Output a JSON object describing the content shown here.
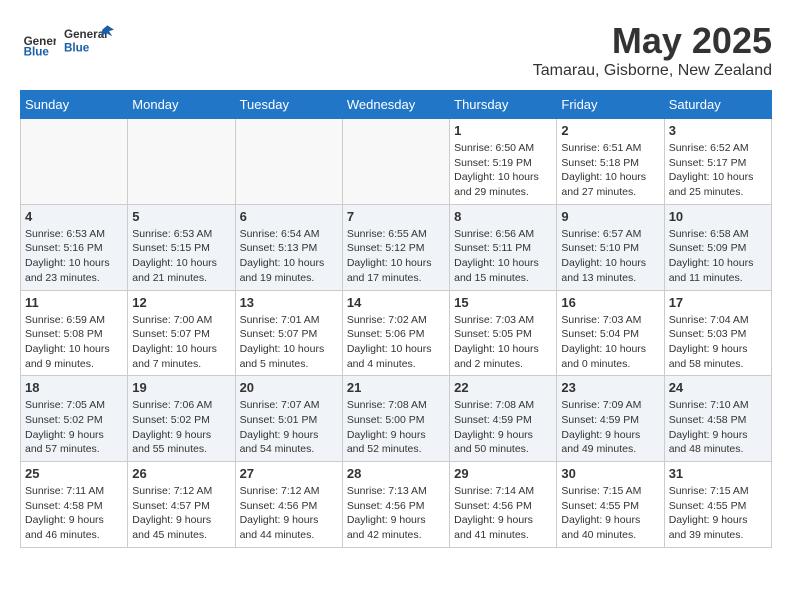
{
  "header": {
    "logo_general": "General",
    "logo_blue": "Blue",
    "month_title": "May 2025",
    "location": "Tamarau, Gisborne, New Zealand"
  },
  "weekdays": [
    "Sunday",
    "Monday",
    "Tuesday",
    "Wednesday",
    "Thursday",
    "Friday",
    "Saturday"
  ],
  "weeks": [
    [
      {
        "day": "",
        "info": ""
      },
      {
        "day": "",
        "info": ""
      },
      {
        "day": "",
        "info": ""
      },
      {
        "day": "",
        "info": ""
      },
      {
        "day": "1",
        "info": "Sunrise: 6:50 AM\nSunset: 5:19 PM\nDaylight: 10 hours\nand 29 minutes."
      },
      {
        "day": "2",
        "info": "Sunrise: 6:51 AM\nSunset: 5:18 PM\nDaylight: 10 hours\nand 27 minutes."
      },
      {
        "day": "3",
        "info": "Sunrise: 6:52 AM\nSunset: 5:17 PM\nDaylight: 10 hours\nand 25 minutes."
      }
    ],
    [
      {
        "day": "4",
        "info": "Sunrise: 6:53 AM\nSunset: 5:16 PM\nDaylight: 10 hours\nand 23 minutes."
      },
      {
        "day": "5",
        "info": "Sunrise: 6:53 AM\nSunset: 5:15 PM\nDaylight: 10 hours\nand 21 minutes."
      },
      {
        "day": "6",
        "info": "Sunrise: 6:54 AM\nSunset: 5:13 PM\nDaylight: 10 hours\nand 19 minutes."
      },
      {
        "day": "7",
        "info": "Sunrise: 6:55 AM\nSunset: 5:12 PM\nDaylight: 10 hours\nand 17 minutes."
      },
      {
        "day": "8",
        "info": "Sunrise: 6:56 AM\nSunset: 5:11 PM\nDaylight: 10 hours\nand 15 minutes."
      },
      {
        "day": "9",
        "info": "Sunrise: 6:57 AM\nSunset: 5:10 PM\nDaylight: 10 hours\nand 13 minutes."
      },
      {
        "day": "10",
        "info": "Sunrise: 6:58 AM\nSunset: 5:09 PM\nDaylight: 10 hours\nand 11 minutes."
      }
    ],
    [
      {
        "day": "11",
        "info": "Sunrise: 6:59 AM\nSunset: 5:08 PM\nDaylight: 10 hours\nand 9 minutes."
      },
      {
        "day": "12",
        "info": "Sunrise: 7:00 AM\nSunset: 5:07 PM\nDaylight: 10 hours\nand 7 minutes."
      },
      {
        "day": "13",
        "info": "Sunrise: 7:01 AM\nSunset: 5:07 PM\nDaylight: 10 hours\nand 5 minutes."
      },
      {
        "day": "14",
        "info": "Sunrise: 7:02 AM\nSunset: 5:06 PM\nDaylight: 10 hours\nand 4 minutes."
      },
      {
        "day": "15",
        "info": "Sunrise: 7:03 AM\nSunset: 5:05 PM\nDaylight: 10 hours\nand 2 minutes."
      },
      {
        "day": "16",
        "info": "Sunrise: 7:03 AM\nSunset: 5:04 PM\nDaylight: 10 hours\nand 0 minutes."
      },
      {
        "day": "17",
        "info": "Sunrise: 7:04 AM\nSunset: 5:03 PM\nDaylight: 9 hours\nand 58 minutes."
      }
    ],
    [
      {
        "day": "18",
        "info": "Sunrise: 7:05 AM\nSunset: 5:02 PM\nDaylight: 9 hours\nand 57 minutes."
      },
      {
        "day": "19",
        "info": "Sunrise: 7:06 AM\nSunset: 5:02 PM\nDaylight: 9 hours\nand 55 minutes."
      },
      {
        "day": "20",
        "info": "Sunrise: 7:07 AM\nSunset: 5:01 PM\nDaylight: 9 hours\nand 54 minutes."
      },
      {
        "day": "21",
        "info": "Sunrise: 7:08 AM\nSunset: 5:00 PM\nDaylight: 9 hours\nand 52 minutes."
      },
      {
        "day": "22",
        "info": "Sunrise: 7:08 AM\nSunset: 4:59 PM\nDaylight: 9 hours\nand 50 minutes."
      },
      {
        "day": "23",
        "info": "Sunrise: 7:09 AM\nSunset: 4:59 PM\nDaylight: 9 hours\nand 49 minutes."
      },
      {
        "day": "24",
        "info": "Sunrise: 7:10 AM\nSunset: 4:58 PM\nDaylight: 9 hours\nand 48 minutes."
      }
    ],
    [
      {
        "day": "25",
        "info": "Sunrise: 7:11 AM\nSunset: 4:58 PM\nDaylight: 9 hours\nand 46 minutes."
      },
      {
        "day": "26",
        "info": "Sunrise: 7:12 AM\nSunset: 4:57 PM\nDaylight: 9 hours\nand 45 minutes."
      },
      {
        "day": "27",
        "info": "Sunrise: 7:12 AM\nSunset: 4:56 PM\nDaylight: 9 hours\nand 44 minutes."
      },
      {
        "day": "28",
        "info": "Sunrise: 7:13 AM\nSunset: 4:56 PM\nDaylight: 9 hours\nand 42 minutes."
      },
      {
        "day": "29",
        "info": "Sunrise: 7:14 AM\nSunset: 4:56 PM\nDaylight: 9 hours\nand 41 minutes."
      },
      {
        "day": "30",
        "info": "Sunrise: 7:15 AM\nSunset: 4:55 PM\nDaylight: 9 hours\nand 40 minutes."
      },
      {
        "day": "31",
        "info": "Sunrise: 7:15 AM\nSunset: 4:55 PM\nDaylight: 9 hours\nand 39 minutes."
      }
    ]
  ]
}
